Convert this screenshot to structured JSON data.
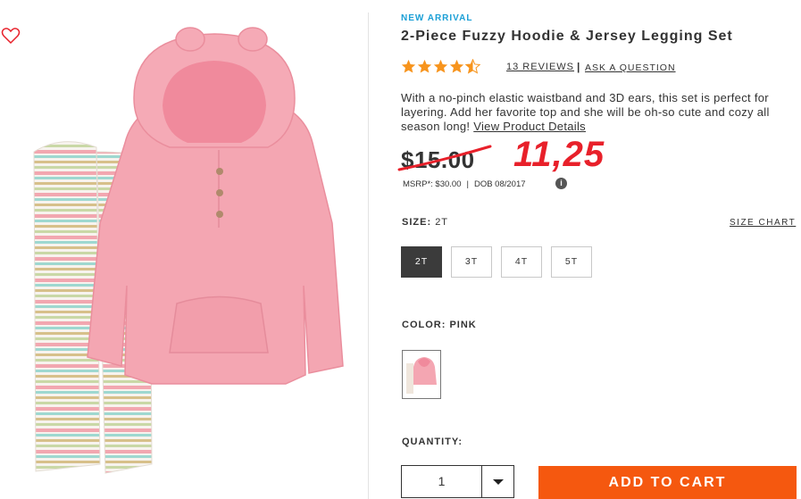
{
  "product": {
    "badge": "NEW ARRIVAL",
    "title": "2-Piece Fuzzy Hoodie & Jersey Legging Set",
    "rating_stars": 4.5,
    "reviews_link": "13 REVIEWS",
    "separator": "|",
    "ask_link": "ASK A QUESTION",
    "description": "With a no-pinch elastic waistband and 3D ears, this set is perfect for layering. Add her favorite top and she will be oh-so cute and cozy all season long!",
    "details_link": "View Product Details",
    "price": "$15.00",
    "handwritten_price": "11,25",
    "msrp": "MSRP*: $30.00",
    "pipe": "|",
    "dob": "DOB 08/2017",
    "info_icon": "i"
  },
  "size": {
    "label": "SIZE:",
    "selected_value": "2T",
    "chart_link": "SIZE CHART",
    "options": [
      "2T",
      "3T",
      "4T",
      "5T"
    ]
  },
  "color": {
    "label": "COLOR: PINK"
  },
  "quantity": {
    "label": "QUANTITY:",
    "value": "1"
  },
  "cart": {
    "button_label": "ADD TO CART"
  },
  "colors": {
    "accent_blue": "#1a9fd6",
    "star": "#f7941d",
    "cart_orange": "#f5580f",
    "handwritten_red": "#e8202a",
    "hoodie_pink": "#f4a6b2"
  },
  "icons": {
    "favorite": "heart-outline-icon",
    "info": "info-icon",
    "dropdown": "chevron-down-icon"
  }
}
